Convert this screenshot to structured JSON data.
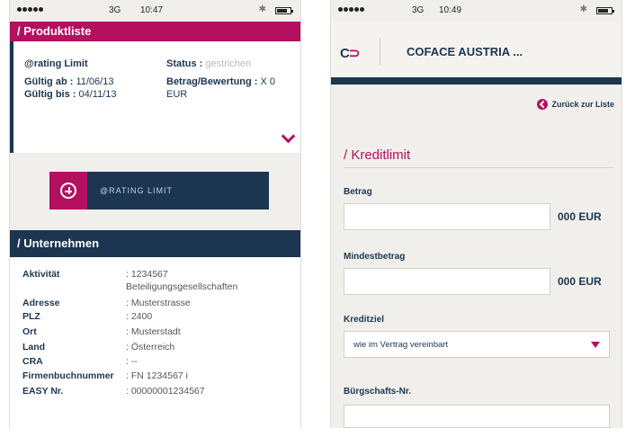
{
  "status_left": {
    "network": "3G",
    "time": "10:47"
  },
  "status_right": {
    "network": "3G",
    "time": "10:49"
  },
  "product_list": {
    "header": "/ Produktliste",
    "rating_label": "@rating Limit",
    "status_label": "Status :",
    "status_value": "gestrichen",
    "valid_from_label": "Gültig ab :",
    "valid_from_value": "11/06/13",
    "valid_to_label": "Gültig bis :",
    "valid_to_value": "04/11/13",
    "amount_label": "Betrag/Bewertung :",
    "amount_value": "X 0",
    "amount_currency": "EUR",
    "rating_button": "@RATING LIMIT"
  },
  "company": {
    "header": "/ Unternehmen",
    "rows": [
      {
        "label": "Aktivität",
        "value": ": 1234567"
      },
      {
        "label": "",
        "value": "Beteiligungsgesellschaften"
      },
      {
        "label": "Adresse",
        "value": ": Musterstrasse"
      },
      {
        "label": "PLZ",
        "value": ": 2400"
      },
      {
        "label": "Ort",
        "value": ": Musterstadt"
      },
      {
        "label": "Land",
        "value": ": Österreich"
      },
      {
        "label": "CRA",
        "value": ": --"
      },
      {
        "label": "Firmenbuchnummer",
        "value": ": FN 1234567 i"
      },
      {
        "label": "EASY Nr.",
        "value": ": 00000001234567"
      }
    ]
  },
  "app": {
    "logo": "CO",
    "title": "COFACE AUSTRIA ...",
    "back_label": "Zurück zur Liste"
  },
  "credit_limit": {
    "title": "/ Kreditlimit",
    "betrag_label": "Betrag",
    "betrag_unit": "000 EUR",
    "mindest_label": "Mindestbetrag",
    "mindest_unit": "000 EUR",
    "kreditziel_label": "Kreditziel",
    "kreditziel_value": "wie im Vertrag vereinbart",
    "buergschaft_label": "Bürgschafts-Nr."
  },
  "colors": {
    "accent": "#b3105f",
    "navy": "#1c3550",
    "background": "#f1efec"
  },
  "icons": [
    "plus-circle-icon",
    "chevron-down-icon",
    "back-arrow-icon",
    "caret-down-icon",
    "battery-icon",
    "bluetooth-icon"
  ]
}
